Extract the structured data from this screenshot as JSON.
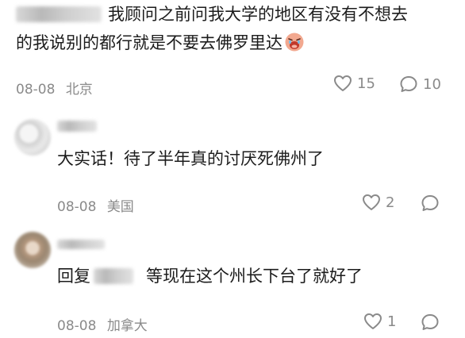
{
  "comments": [
    {
      "text_line1": "我顾问之前问我大学的地区有没有不想去",
      "text_line2": "的我说别的都行就是不要去佛罗里达",
      "date": "08-08",
      "location": "北京",
      "likes": "15",
      "replies": "10"
    },
    {
      "text": "大实话！待了半年真的讨厌死佛州了",
      "date": "08-08",
      "location": "美国",
      "likes": "2"
    },
    {
      "reply_prefix": "回复",
      "text": "等现在这个州长下台了就好了",
      "date": "08-08",
      "location": "加拿大",
      "likes": "1"
    }
  ],
  "icons": {
    "like": "heart-outline-icon",
    "comment": "speech-bubble-icon",
    "emoji": "crying-face-emoji"
  },
  "colors": {
    "text": "#1c1c1c",
    "meta": "#8a8a8a",
    "background": "#ffffff"
  }
}
